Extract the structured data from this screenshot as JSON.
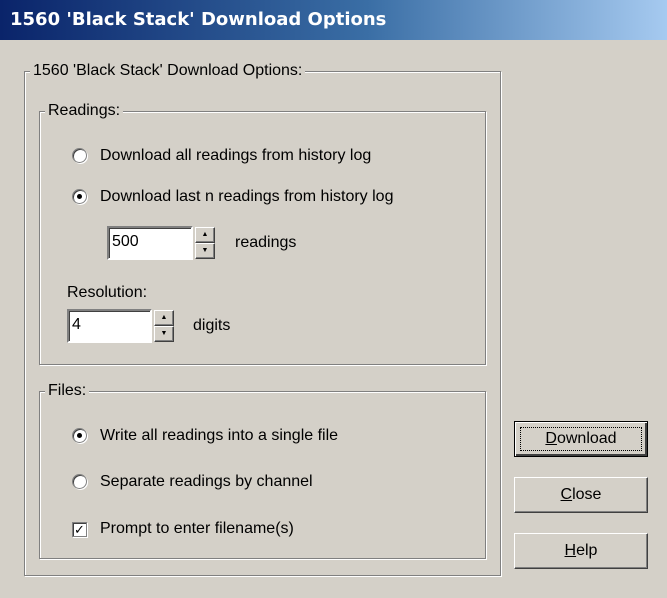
{
  "window": {
    "title": "1560 'Black Stack' Download Options"
  },
  "main_group": {
    "label": "1560 'Black Stack' Download Options:"
  },
  "readings": {
    "label": "Readings:",
    "option_all": {
      "label": "Download all readings from history log",
      "selected": false
    },
    "option_last": {
      "label": "Download last n readings from history log",
      "selected": true
    },
    "count": {
      "value": "500",
      "unit": "readings"
    },
    "resolution": {
      "label": "Resolution:",
      "value": "4",
      "unit": "digits"
    }
  },
  "files": {
    "label": "Files:",
    "option_single": {
      "label": "Write all readings into a single file",
      "selected": true
    },
    "option_channel": {
      "label": "Separate readings by channel",
      "selected": false
    },
    "prompt": {
      "label": "Prompt to enter filename(s)",
      "checked": true
    }
  },
  "buttons": {
    "download": {
      "accel": "D",
      "rest": "ownload"
    },
    "close": {
      "accel": "C",
      "rest": "lose"
    },
    "help": {
      "accel": "H",
      "rest": "elp"
    }
  },
  "colors": {
    "face": "#d4d0c8",
    "title_start": "#0a246a",
    "title_end": "#a6caf0"
  }
}
